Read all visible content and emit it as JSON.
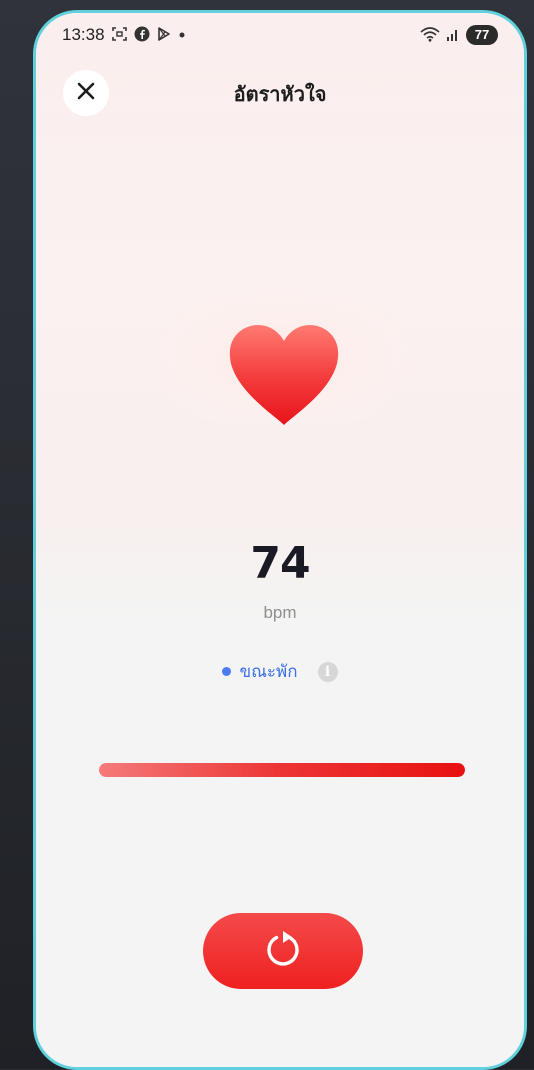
{
  "status_bar": {
    "time": "13:38",
    "battery": "77",
    "icons": [
      "screenshot-icon",
      "facebook-icon",
      "play-store-icon",
      "dot-icon",
      "wifi-icon",
      "signal-icon"
    ]
  },
  "header": {
    "title": "อัตราหัวใจ"
  },
  "measurement": {
    "value": "74",
    "unit": "bpm",
    "state_label": "ขณะพัก",
    "progress": 1.0
  },
  "colors": {
    "accent_red": "#ef2020",
    "state_blue": "#4a7df0",
    "frame": "#5fd0dc"
  }
}
